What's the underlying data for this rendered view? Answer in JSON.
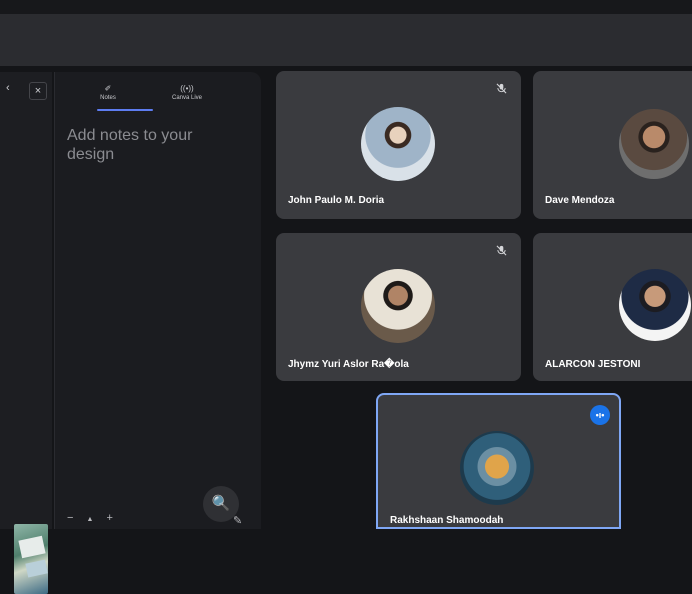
{
  "notes_panel": {
    "tabs": [
      {
        "label": "Notes",
        "icon": "notes-icon"
      },
      {
        "label": "Canva Live",
        "icon": "broadcast-icon"
      }
    ],
    "placeholder": "Add notes to your design",
    "zoom_controls": {
      "minus": "−",
      "mountain": "▲",
      "plus": "+"
    },
    "zoom_icon": "🔍",
    "edit_icon": "✎"
  },
  "left_strip": {
    "close_icon": "×"
  },
  "participants": [
    {
      "name": "John Paulo M. Doria",
      "muted": true,
      "avatar_color": "#9fb4c8"
    },
    {
      "name": "Dave Mendoza",
      "muted": false,
      "avatar_color": "#5a4a40"
    },
    {
      "name": "Jhymz Yuri Aslor Ra�ola",
      "muted": true,
      "avatar_color": "#6a5a4a"
    },
    {
      "name": "ALARCON JESTONI",
      "muted": false,
      "avatar_color": "#f4f4f4"
    },
    {
      "name": "Rakhshaan Shamoodah",
      "muted": false,
      "speaking": true,
      "avatar_color": "#2f5f7a"
    }
  ],
  "icons": {
    "mute": "🎙",
    "speaking": "•ı•"
  },
  "colors": {
    "background": "#141518",
    "tile": "#3a3b3f",
    "accent": "#1a73e8",
    "speaking_border": "#7fa7f5"
  }
}
